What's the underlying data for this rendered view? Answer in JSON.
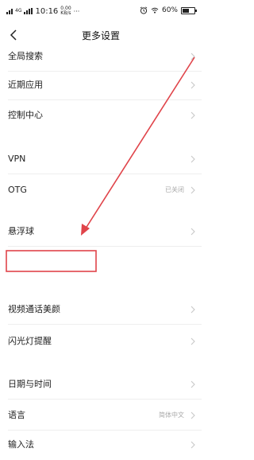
{
  "status_bar": {
    "network": "4G",
    "time": "10:16",
    "speed_value": "0.00",
    "speed_unit": "KB/s",
    "overflow": "···",
    "battery_text": "60%",
    "battery_level": 0.6
  },
  "header": {
    "back_icon": "chevron-left-icon",
    "title": "更多设置"
  },
  "settings": [
    {
      "label": "全局搜索",
      "value": ""
    },
    {
      "label": "近期应用",
      "value": ""
    },
    {
      "label": "控制中心",
      "value": ""
    },
    {
      "label": "VPN",
      "value": ""
    },
    {
      "label": "OTG",
      "value": "已关闭"
    },
    {
      "label": "悬浮球",
      "value": ""
    },
    {
      "label": "视频通话美颜",
      "value": ""
    },
    {
      "label": "闪光灯提醒",
      "value": ""
    },
    {
      "label": "日期与时间",
      "value": ""
    },
    {
      "label": "语言",
      "value": "简体中文"
    },
    {
      "label": "输入法",
      "value": ""
    }
  ],
  "colors": {
    "annotation": "#e0444a",
    "divider": "#eeeeee",
    "secondary_text": "#aaaaaa"
  }
}
